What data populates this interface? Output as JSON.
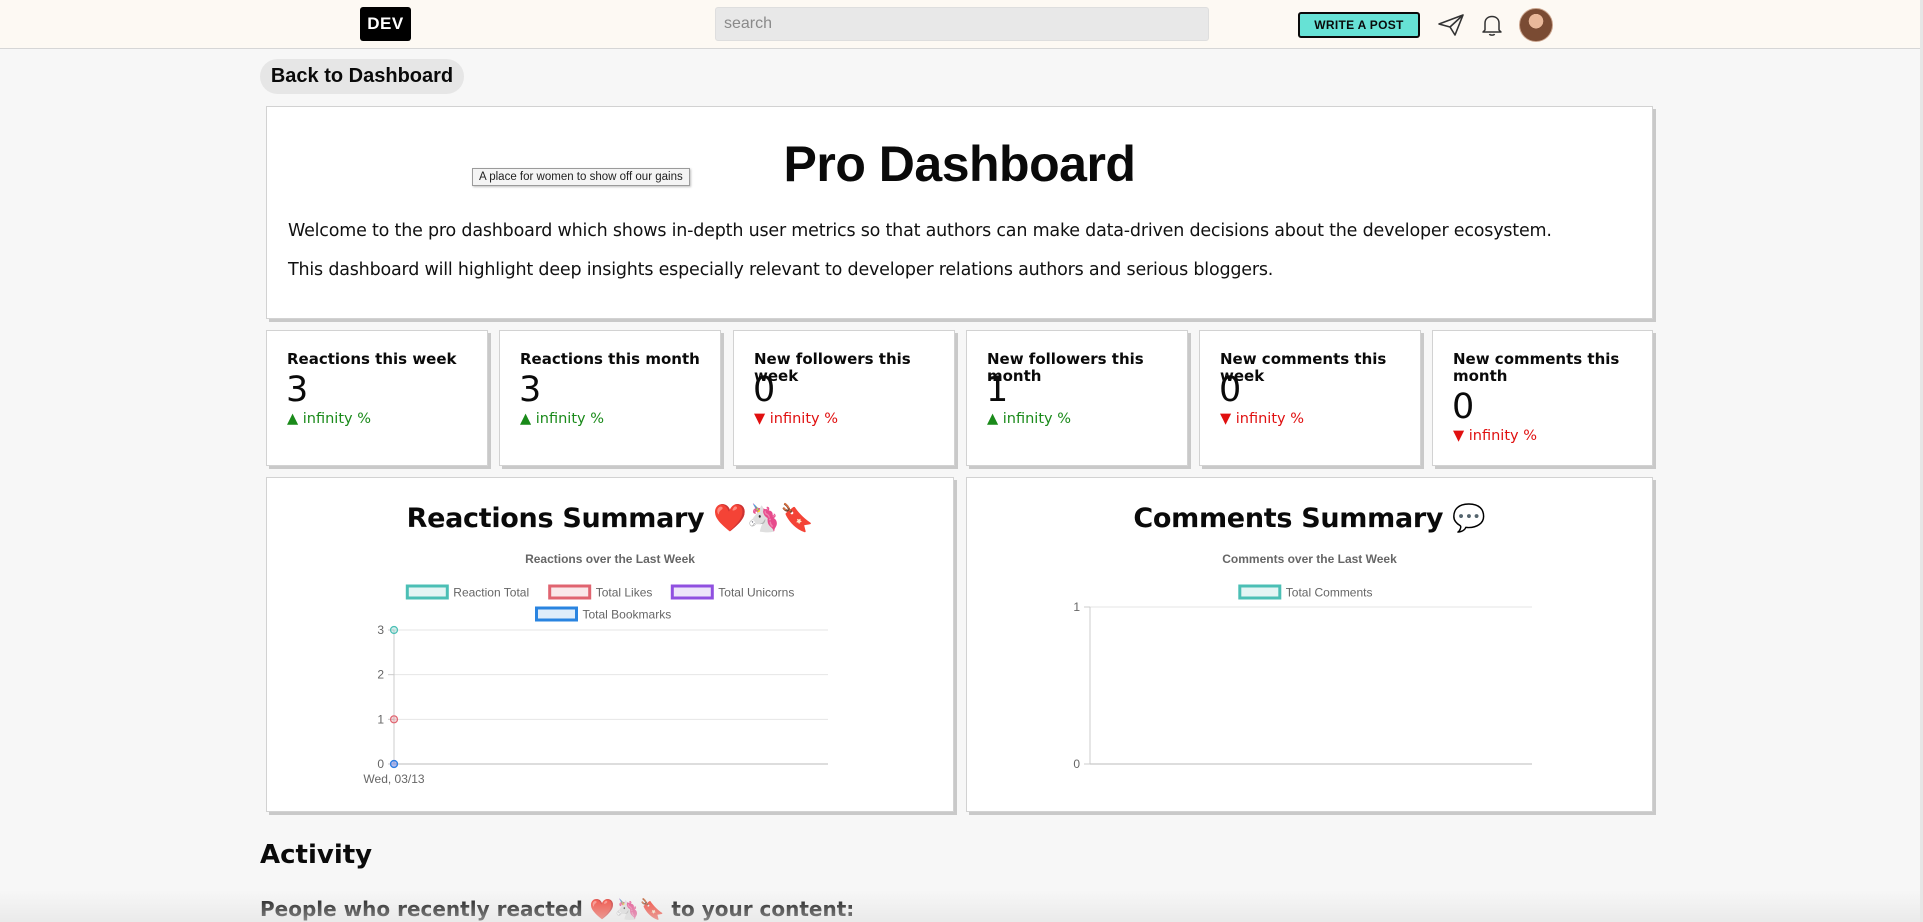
{
  "nav": {
    "logo": "DEV",
    "search_placeholder": "search",
    "write_post_label": "WRITE A POST",
    "icons": [
      "paper-plane-icon",
      "bell-icon",
      "avatar"
    ]
  },
  "back_label": "Back to Dashboard",
  "hero": {
    "title": "Pro Dashboard",
    "tooltip": "A place for women to show off our gains",
    "paragraphs": [
      "Welcome to the pro dashboard which shows in-depth user metrics so that authors can make data-driven decisions about the developer ecosystem.",
      "This dashboard will highlight deep insights especially relevant to developer relations authors and serious bloggers."
    ]
  },
  "stats": [
    {
      "label": "Reactions this week",
      "value": "3",
      "change": "▲ infinity %",
      "direction": "up"
    },
    {
      "label": "Reactions this month",
      "value": "3",
      "change": "▲ infinity %",
      "direction": "up"
    },
    {
      "label": "New followers this week",
      "value": "0",
      "change": "▼ infinity %",
      "direction": "down"
    },
    {
      "label": "New followers this month",
      "value": "1",
      "change": "▲ infinity %",
      "direction": "up"
    },
    {
      "label": "New comments this week",
      "value": "0",
      "change": "▼ infinity %",
      "direction": "down"
    },
    {
      "label": "New comments this month",
      "value": "0",
      "change": "▼ infinity %",
      "direction": "down"
    }
  ],
  "colors": {
    "up": "#1a8a1a",
    "down": "#e01010",
    "accent": "#66e2d5"
  },
  "charts": {
    "reactions": {
      "heading": "Reactions Summary ❤️🦄🔖",
      "subtitle": "Reactions over the Last Week"
    },
    "comments": {
      "heading": "Comments Summary 💬",
      "subtitle": "Comments over the Last Week"
    }
  },
  "chart_data": [
    {
      "type": "line",
      "title": "Reactions over the Last Week",
      "categories": [
        "Wed, 03/13"
      ],
      "ylim": [
        0,
        3
      ],
      "yticks": [
        "0",
        "1",
        "2",
        "3"
      ],
      "legend": "top",
      "grid": true,
      "series": [
        {
          "name": "Reaction Total",
          "values": [
            3
          ],
          "color": "#4bbfb5"
        },
        {
          "name": "Total Likes",
          "values": [
            1
          ],
          "color": "#e06470"
        },
        {
          "name": "Total Unicorns",
          "values": [
            0
          ],
          "color": "#9050e0"
        },
        {
          "name": "Total Bookmarks",
          "values": [
            0
          ],
          "color": "#2a84e0"
        }
      ]
    },
    {
      "type": "line",
      "title": "Comments over the Last Week",
      "categories": [],
      "ylim": [
        0,
        1
      ],
      "yticks": [
        "0",
        "1"
      ],
      "legend": "top",
      "grid": true,
      "series": [
        {
          "name": "Total Comments",
          "values": [],
          "color": "#4bbfb5"
        }
      ]
    }
  ],
  "activity": {
    "heading": "Activity",
    "subheading": "People who recently reacted ❤️🦄🔖 to your content:"
  }
}
